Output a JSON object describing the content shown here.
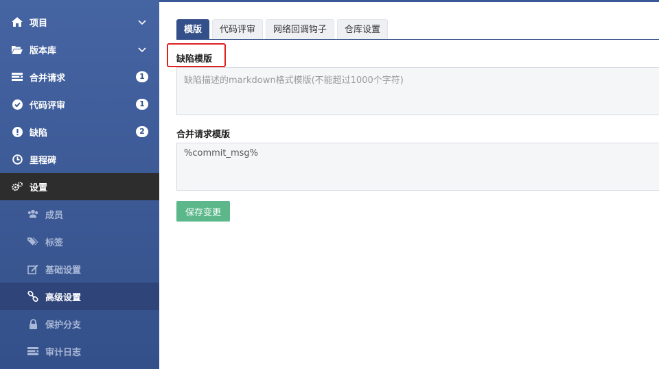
{
  "sidebar": {
    "items": [
      {
        "label": "项目",
        "icon": "home-icon",
        "chevron": true
      },
      {
        "label": "版本库",
        "icon": "folder-open-icon",
        "chevron": true
      },
      {
        "label": "合并请求",
        "icon": "merge-request-icon",
        "badge": "1"
      },
      {
        "label": "代码评审",
        "icon": "check-circle-icon",
        "badge": "1"
      },
      {
        "label": "缺陷",
        "icon": "exclamation-circle-icon",
        "badge": "2"
      },
      {
        "label": "里程碑",
        "icon": "clock-icon"
      },
      {
        "label": "设置",
        "icon": "gears-icon",
        "active": true
      }
    ],
    "sub_items": [
      {
        "label": "成员",
        "icon": "users-icon"
      },
      {
        "label": "标签",
        "icon": "tags-icon"
      },
      {
        "label": "基础设置",
        "icon": "edit-icon"
      },
      {
        "label": "高级设置",
        "icon": "link-icon",
        "current": true
      },
      {
        "label": "保护分支",
        "icon": "lock-icon"
      },
      {
        "label": "审计日志",
        "icon": "list-icon"
      }
    ]
  },
  "tabs": [
    {
      "label": "模版",
      "active": true
    },
    {
      "label": "代码评审"
    },
    {
      "label": "网络回调钩子"
    },
    {
      "label": "仓库设置"
    }
  ],
  "form": {
    "defect_label": "缺陷模版",
    "defect_placeholder": "缺陷描述的markdown格式模版(不能超过1000个字符)",
    "defect_value": "",
    "merge_label": "合并请求模版",
    "merge_value": "%commit_msg%",
    "save_label": "保存变更"
  },
  "colors": {
    "sidebar": "#3b5998",
    "active_nav": "#2d2d2d",
    "save_button": "#5cb88a",
    "highlight": "#e02020"
  }
}
